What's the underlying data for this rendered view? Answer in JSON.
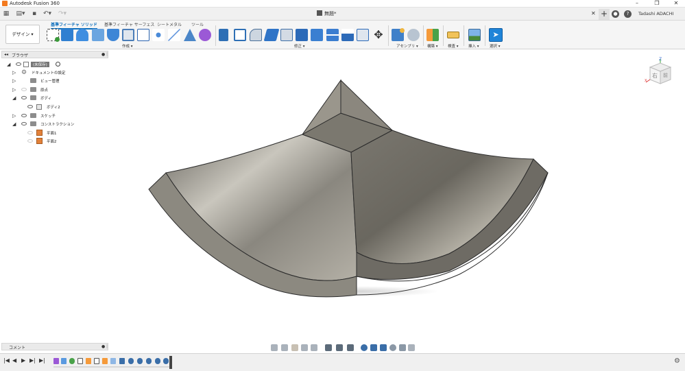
{
  "app": {
    "title": "Autodesk Fusion 360"
  },
  "window_controls": [
    "–",
    "❐",
    "✕"
  ],
  "document": {
    "name": "無題*",
    "user": "Tadashi ADACHI"
  },
  "workspace": {
    "label": "デザイン ▾"
  },
  "toolbar": {
    "tabs": [
      {
        "label": "基準フィーチャ ソリッド",
        "active": true
      },
      {
        "label": "基準フィーチャ サーフェス",
        "active": false
      },
      {
        "label": "シートメタル",
        "active": false
      },
      {
        "label": "ツール",
        "active": false
      }
    ],
    "groups": [
      {
        "label": "作成 ▾"
      },
      {
        "label": "修正 ▾"
      },
      {
        "label": "アセンブリ ▾"
      },
      {
        "label": "構築 ▾"
      },
      {
        "label": "検査 ▾"
      },
      {
        "label": "挿入 ▾"
      },
      {
        "label": "選択 ▾"
      }
    ]
  },
  "browser": {
    "title": "ブラウザ",
    "nodes": [
      {
        "label": "(未保存)",
        "level": 0
      },
      {
        "label": "ドキュメントの設定",
        "level": 1
      },
      {
        "label": "ビュー管理",
        "level": 1
      },
      {
        "label": "原点",
        "level": 1
      },
      {
        "label": "ボディ",
        "level": 1
      },
      {
        "label": "ボディ2",
        "level": 2
      },
      {
        "label": "スケッチ",
        "level": 1
      },
      {
        "label": "コンストラクション",
        "level": 1
      },
      {
        "label": "平面1",
        "level": 2
      },
      {
        "label": "平面2",
        "level": 2
      }
    ]
  },
  "viewcube": {
    "face_label": "右",
    "side_label": "前",
    "axis_z": "Z",
    "axis_x": "X"
  },
  "comments": {
    "title": "コメント"
  },
  "colors": {
    "accent": "#0d6fbd",
    "model": "#8e8b82",
    "model_dark": "#6f6c65"
  },
  "icons": {
    "toolbar": [
      "new-component-icon",
      "extrude-icon",
      "revolve-icon",
      "sweep-icon",
      "loft-icon",
      "rib-icon",
      "web-icon",
      "pattern-icon",
      "mirror-icon",
      "thicken-icon",
      "boundary-fill-icon",
      "press-pull-icon",
      "fillet-icon",
      "chamfer-icon",
      "shell-icon",
      "draft-icon",
      "scale-icon",
      "combine-icon",
      "split-icon",
      "move-icon",
      "assemble-icon",
      "joint-icon",
      "offset-plane-icon",
      "measure-icon",
      "insert-image-icon",
      "select-icon"
    ]
  }
}
